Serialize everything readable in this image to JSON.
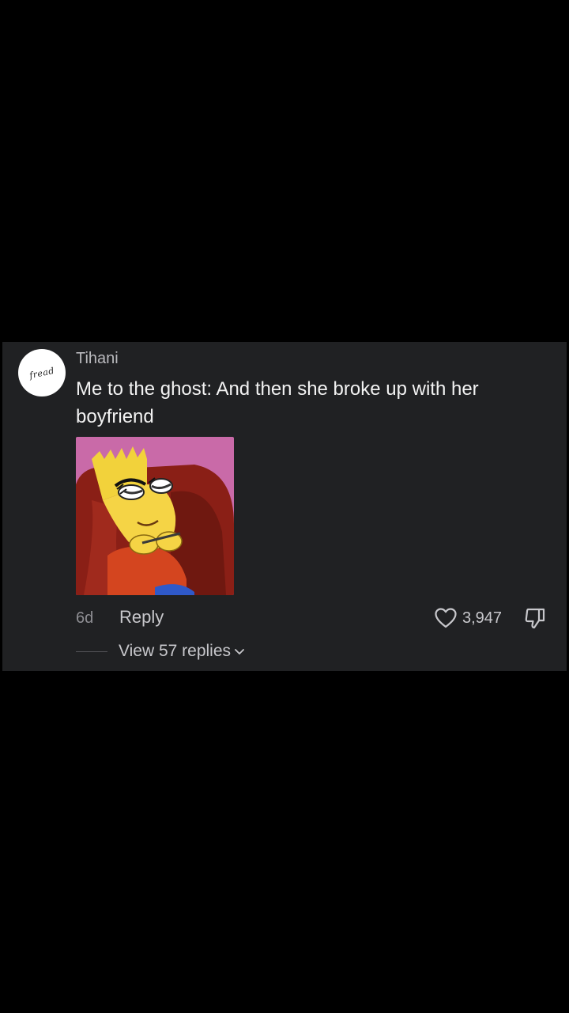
{
  "comment": {
    "username": "Tihani",
    "avatar_text": "fread",
    "text": "Me to the ghost: And then she broke up with her boyfriend",
    "image_icon": "cartoon-character-image",
    "time": "6d",
    "reply_label": "Reply",
    "like_count": "3,947",
    "view_replies_label": "View 57 replies"
  },
  "icons": {
    "like": "heart-outline-icon",
    "dislike": "thumbs-down-outline-icon",
    "expand": "chevron-down-icon"
  },
  "colors": {
    "background": "#000000",
    "card": "#202123",
    "text_primary": "#f2f2f2",
    "text_secondary": "#c8c8cc",
    "text_muted": "#8e8e93"
  }
}
